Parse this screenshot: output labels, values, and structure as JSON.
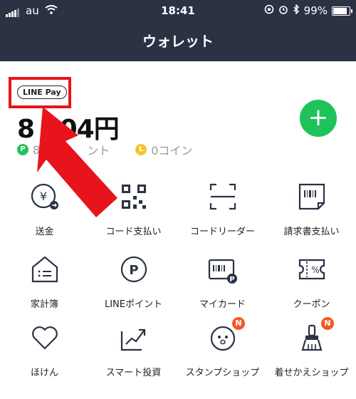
{
  "status": {
    "carrier": "au",
    "time": "18:41",
    "battery": "99%"
  },
  "header": {
    "title": "ウォレット"
  },
  "balance": {
    "badge": "LINE Pay",
    "amount": "8 104円",
    "points_label": "8",
    "points_suffix": "ント",
    "coin_label": "0コイン"
  },
  "plus_label": "+",
  "grid": [
    {
      "label": "送金",
      "icon": "send-money-icon"
    },
    {
      "label": "コード支払い",
      "icon": "qr-code-icon"
    },
    {
      "label": "コードリーダー",
      "icon": "scanner-icon"
    },
    {
      "label": "請求書支払い",
      "icon": "invoice-icon"
    },
    {
      "label": "家計簿",
      "icon": "household-icon"
    },
    {
      "label": "LINEポイント",
      "icon": "points-icon"
    },
    {
      "label": "マイカード",
      "icon": "card-icon"
    },
    {
      "label": "クーポン",
      "icon": "coupon-icon"
    },
    {
      "label": "ほけん",
      "icon": "heart-icon"
    },
    {
      "label": "スマート投資",
      "icon": "chart-icon"
    },
    {
      "label": "スタンプショップ",
      "icon": "sticker-icon",
      "badge": "N"
    },
    {
      "label": "着せかえショップ",
      "icon": "brush-icon",
      "badge": "N"
    }
  ],
  "colors": {
    "header": "#2a3244",
    "accent": "#1fc35a",
    "annotation": "#e8141c",
    "new_badge": "#f35a25"
  }
}
